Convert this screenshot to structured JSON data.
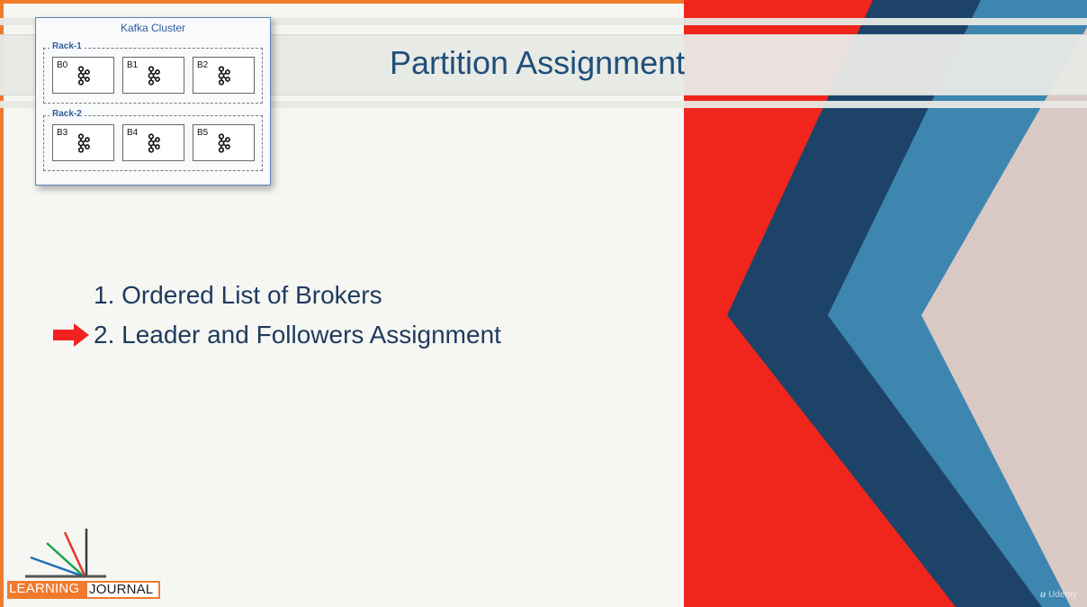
{
  "slide": {
    "title": "Partition Assignment",
    "points": [
      "1. Ordered List of Brokers",
      "2. Leader and Followers Assignment"
    ],
    "active_point": 2
  },
  "cluster": {
    "title": "Kafka Cluster",
    "racks": [
      {
        "label": "Rack-1",
        "brokers": [
          "B0",
          "B1",
          "B2"
        ]
      },
      {
        "label": "Rack-2",
        "brokers": [
          "B3",
          "B4",
          "B5"
        ]
      }
    ],
    "broker_icon": "kafka-logo-icon"
  },
  "logo": {
    "word1": "LEARNING",
    "word2": "JOURNAL"
  },
  "watermark": {
    "mark": "u",
    "text": "Udemy"
  },
  "colors": {
    "accent_orange": "#f07a2c",
    "title_blue": "#1f4f79",
    "text_navy": "#1f3a5f",
    "arrow_red": "#f2231f",
    "art_red": "#f0261c",
    "art_navy": "#1d4468",
    "art_teal": "#3d86b0",
    "art_pink": "#d9c8c4"
  },
  "icons": {
    "pointer": "red-arrow-icon",
    "broker": "kafka-logo-icon"
  }
}
